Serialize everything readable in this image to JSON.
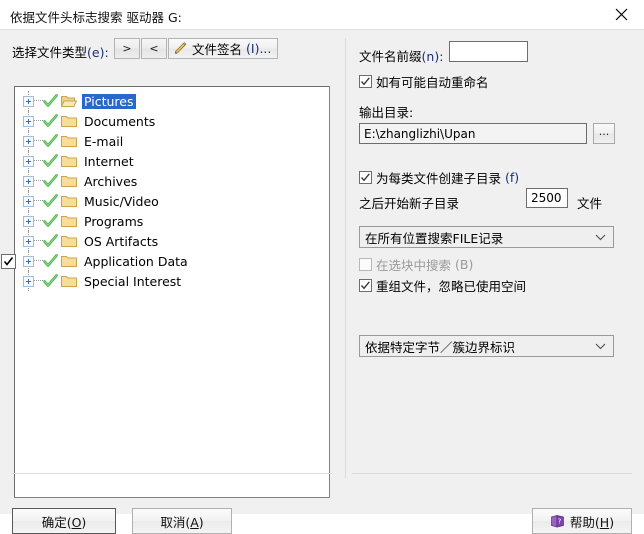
{
  "window": {
    "title": "依据文件头标志搜索 驱动器 G:",
    "close_icon": "close-icon"
  },
  "left": {
    "filetype_label": "选择文件类型",
    "filetype_mnemonic": "(e):",
    "next_button": ">",
    "prev_button": "<",
    "signature_button": "文件签名",
    "signature_mnemonic": "(I)...",
    "tree": [
      {
        "label": "Pictures",
        "selected": true
      },
      {
        "label": "Documents",
        "selected": false
      },
      {
        "label": "E-mail",
        "selected": false
      },
      {
        "label": "Internet",
        "selected": false
      },
      {
        "label": "Archives",
        "selected": false
      },
      {
        "label": "Music/Video",
        "selected": false
      },
      {
        "label": "Programs",
        "selected": false
      },
      {
        "label": "OS Artifacts",
        "selected": false
      },
      {
        "label": "Application Data",
        "selected": false
      },
      {
        "label": "Special Interest",
        "selected": false
      }
    ]
  },
  "right": {
    "prefix_label": "文件名前缀",
    "prefix_mnemonic": "(n):",
    "prefix_value": "",
    "auto_rename_label": "如有可能自动重命名",
    "auto_rename_checked": true,
    "output_dir_label": "输出目录:",
    "output_dir_value": "E:\\zhanglizhi\\Upan",
    "browse_button": "...",
    "create_subdir_label": "为每类文件创建子目录",
    "create_subdir_mnemonic": "(f)",
    "create_subdir_checked": true,
    "new_subdir_label": "之后开始新子目录",
    "new_subdir_count": "2500",
    "new_subdir_unit": "文件",
    "search_scope_option": "在所有位置搜索FILE记录",
    "search_in_block_label": "在选块中搜索",
    "search_in_block_mnemonic": "(B)",
    "search_in_block_checked": false,
    "search_in_block_disabled": true,
    "regroup_label": "重组文件，忽略已使用空间",
    "regroup_checked": true,
    "boundary_option": "依据特定字节／簇边界标识"
  },
  "footer": {
    "ok_label": "确定(",
    "ok_mnemonic": "O",
    "ok_suffix": ")",
    "cancel_label": "取消(",
    "cancel_mnemonic": "A",
    "cancel_suffix": ")",
    "help_label": "帮助(",
    "help_mnemonic": "H",
    "help_suffix": ")"
  },
  "colors": {
    "selection_blue": "#2968c8",
    "mnemonic_blue": "#1a2f7a",
    "folder_yellow": "#f7d98a",
    "check_green": "#3fa93f",
    "help_purple": "#7d4fa8"
  }
}
